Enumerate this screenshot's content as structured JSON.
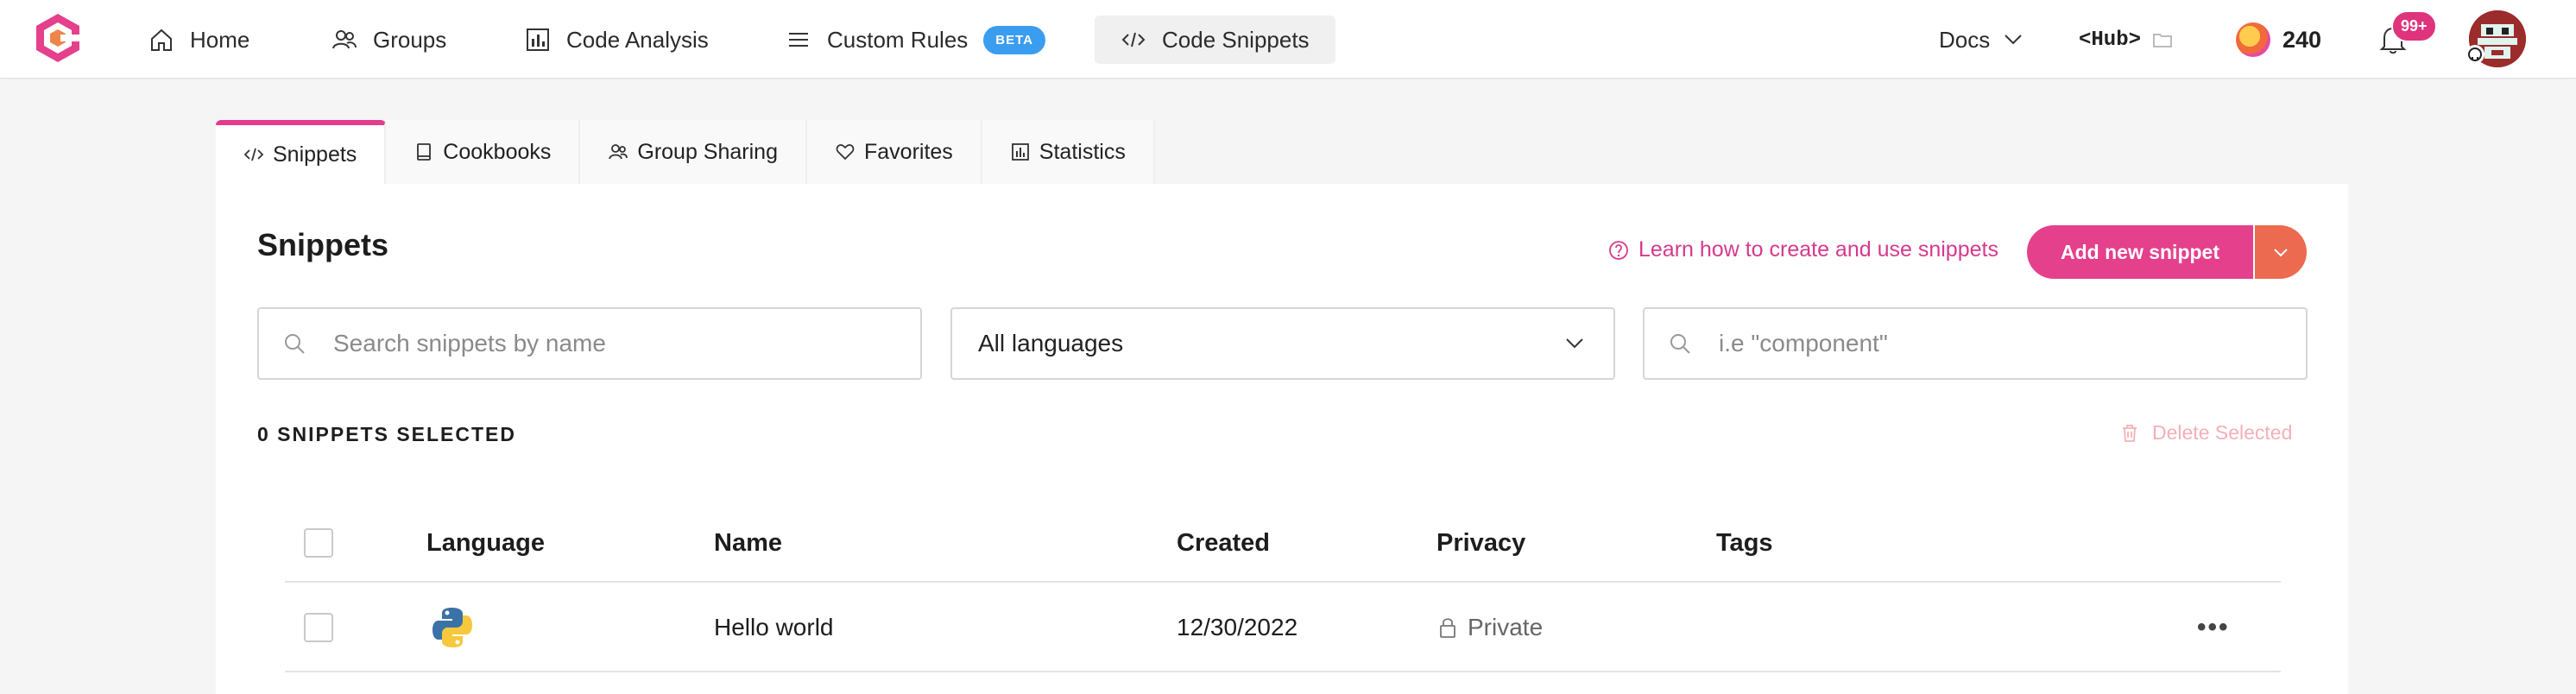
{
  "nav": {
    "items": [
      {
        "label": "Home",
        "icon": "home-icon"
      },
      {
        "label": "Groups",
        "icon": "groups-icon"
      },
      {
        "label": "Code Analysis",
        "icon": "code-analysis-icon"
      },
      {
        "label": "Custom Rules",
        "icon": "list-icon",
        "badge": "BETA"
      },
      {
        "label": "Code Snippets",
        "icon": "code-icon",
        "active": true
      }
    ],
    "docs_label": "Docs",
    "hub_label": "<Hub>",
    "coins": "240",
    "notifications": "99+",
    "colors": {
      "accent": "#e5408c",
      "beta": "#3b9df0"
    }
  },
  "tabs": [
    {
      "label": "Snippets",
      "icon": "code-icon",
      "active": true
    },
    {
      "label": "Cookbooks",
      "icon": "book-icon"
    },
    {
      "label": "Group Sharing",
      "icon": "groups-icon"
    },
    {
      "label": "Favorites",
      "icon": "heart-icon"
    },
    {
      "label": "Statistics",
      "icon": "chart-icon"
    }
  ],
  "main": {
    "title": "Snippets",
    "learn_link": "Learn how to create and use snippets",
    "add_button": "Add new snippet",
    "search_placeholder": "Search snippets by name",
    "language_select": "All languages",
    "tag_placeholder": "i.e \"component\"",
    "selected_count": "0 SNIPPETS SELECTED",
    "delete_label": "Delete Selected"
  },
  "table": {
    "headers": {
      "language": "Language",
      "name": "Name",
      "created": "Created",
      "privacy": "Privacy",
      "tags": "Tags"
    },
    "rows": [
      {
        "language": "python-icon",
        "name": "Hello world",
        "created": "12/30/2022",
        "privacy": "Private",
        "tags": "",
        "menu": "•••"
      }
    ]
  }
}
